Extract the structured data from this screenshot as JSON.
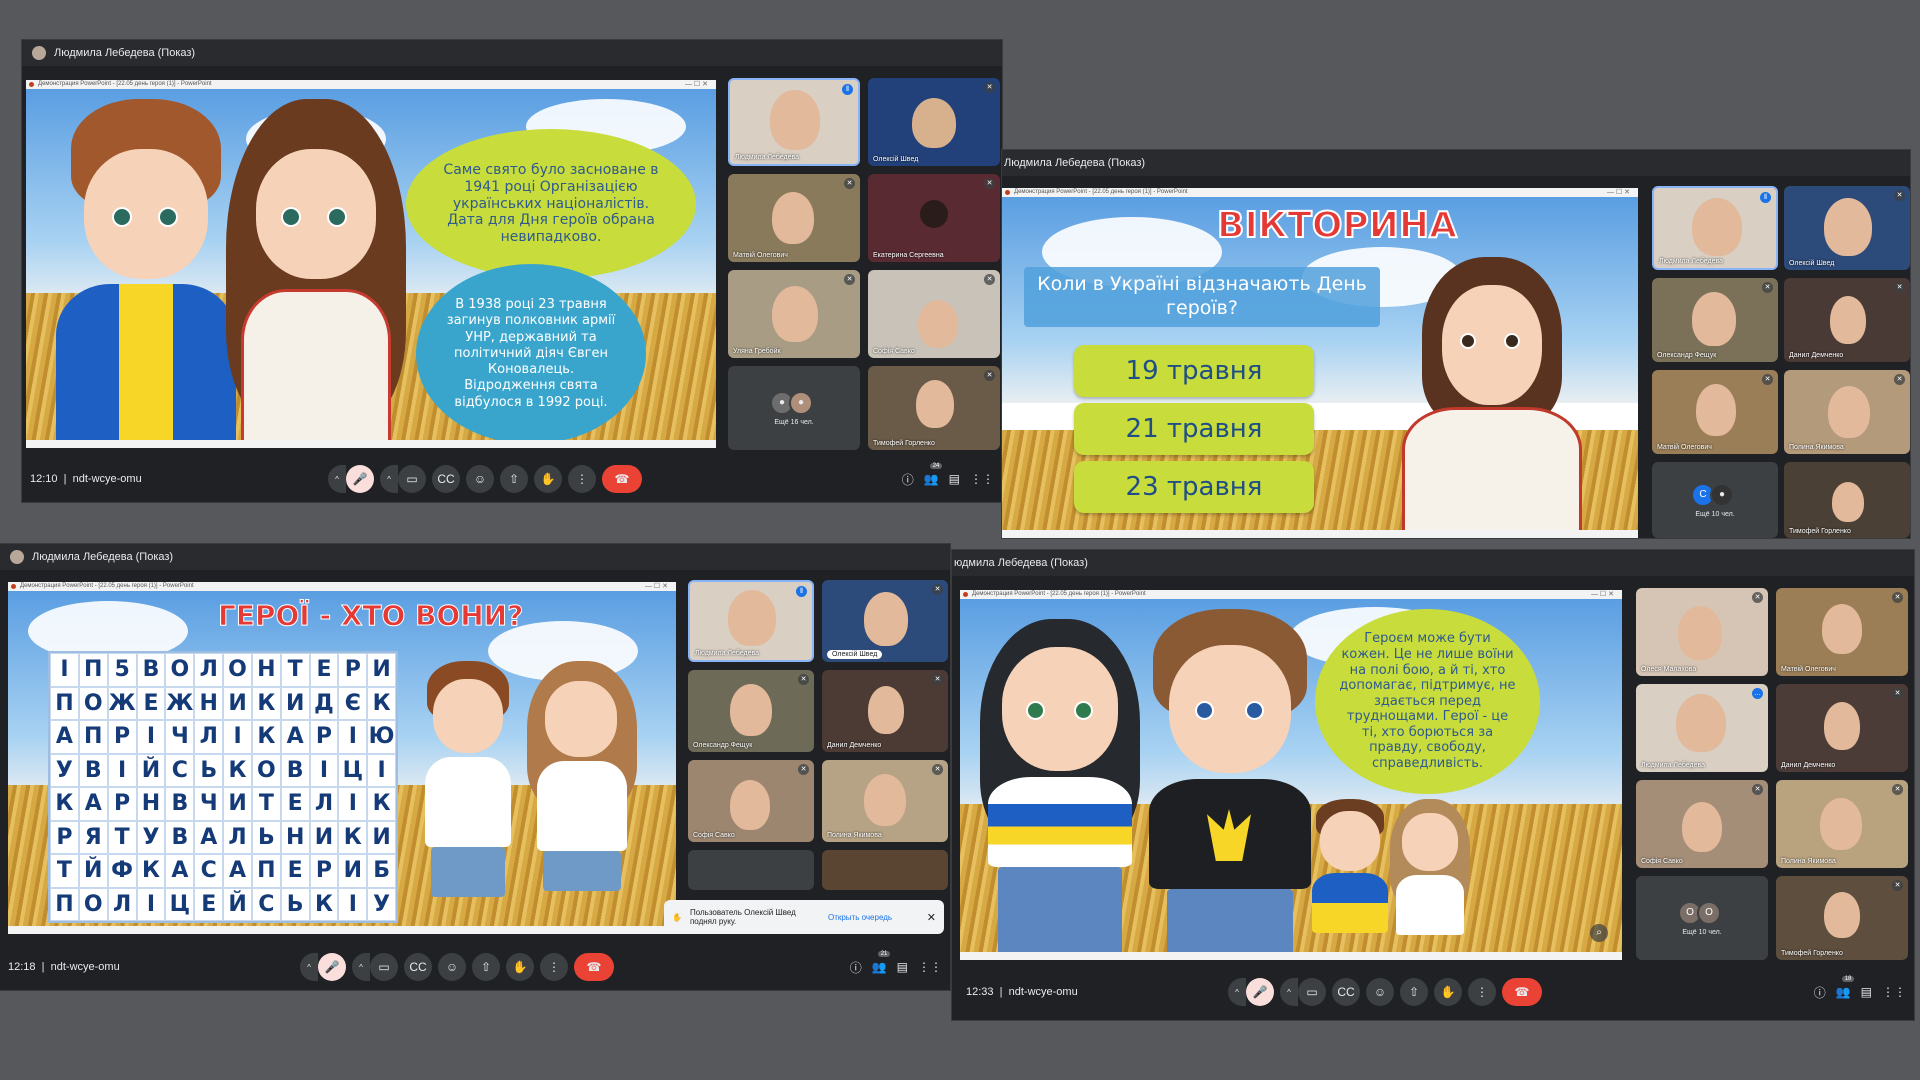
{
  "presenter_title": "Людмила Лебедева (Показ)",
  "presenter_title_cut": "юдмила Лебедева (Показ)",
  "ppt_window_title": "Демонстрация PowerPoint - [22.05 день героя (1)] - PowerPoint",
  "meeting_code": "ndt-wcye-omu",
  "panel1": {
    "time": "12:10",
    "bubble_green": "Саме свято було засноване в 1941 році Організацією українських націоналістів. Дата для Дня героїв обрана невипадково.",
    "bubble_blue": "В 1938 році 23 травня загинув полковник армії УНР, державний та політичний діяч Євген Коновалець. Відродження свята відбулося в 1992 році.",
    "participants_badge": "24",
    "tiles": [
      "Людмила Лебедева",
      "Олексій Швед",
      "Матвій Олегович",
      "Екатерина Сергеевна",
      "Уляна Гребойк",
      "Софія Савко",
      "Ещё 16 чел.",
      "Тимофей Горленко"
    ]
  },
  "panel2": {
    "title": "ВІКТОРИНА",
    "question": "Коли в Україні відзначають День героїв?",
    "options": [
      "19 травня",
      "21 травня",
      "23 травня"
    ],
    "tiles": [
      "Людмила Лебедева",
      "Олексій Швед",
      "Олександр Фещук",
      "Данил Демченко",
      "Матвій Олегович",
      "Полина Якимова",
      "Ещё 10 чел.",
      "Тимофей Горленко"
    ]
  },
  "panel3": {
    "time": "12:18",
    "title": "ГЕРОЇ - ХТО ВОНИ?",
    "grid": [
      [
        "І",
        "П",
        "5",
        "В",
        "О",
        "Л",
        "О",
        "Н",
        "Т",
        "Е",
        "Р",
        "И"
      ],
      [
        "П",
        "О",
        "Ж",
        "Е",
        "Ж",
        "Н",
        "И",
        "К",
        "И",
        "Д",
        "Є",
        "К"
      ],
      [
        "А",
        "П",
        "Р",
        "І",
        "Ч",
        "Л",
        "І",
        "К",
        "А",
        "Р",
        "І",
        "Ю"
      ],
      [
        "У",
        "В",
        "І",
        "Й",
        "С",
        "Ь",
        "К",
        "О",
        "В",
        "І",
        "Ц",
        "І"
      ],
      [
        "К",
        "А",
        "Р",
        "Н",
        "В",
        "Ч",
        "И",
        "Т",
        "Е",
        "Л",
        "І",
        "К"
      ],
      [
        "Р",
        "Я",
        "Т",
        "У",
        "В",
        "А",
        "Л",
        "Ь",
        "Н",
        "И",
        "К",
        "И"
      ],
      [
        "Т",
        "Й",
        "Ф",
        "К",
        "А",
        "С",
        "А",
        "П",
        "Е",
        "Р",
        "И",
        "Б"
      ],
      [
        "П",
        "О",
        "Л",
        "І",
        "Ц",
        "Е",
        "Й",
        "С",
        "Ь",
        "К",
        "І",
        "У"
      ]
    ],
    "toast_text": "Пользователь Олексій Швед поднял руку.",
    "toast_link": "Открыть очередь",
    "participants_badge": "21",
    "tiles": [
      "Людмила Лебедева",
      "Олексій Швед",
      "Олександр Фещук",
      "Данил Демченко",
      "Софія Савко",
      "Полина Якимова",
      "",
      ""
    ]
  },
  "panel4": {
    "time": "12:33",
    "bubble": "Героєм може бути кожен. Це не лише воїни на полі бою, а й ті, хто допомагає, підтримує, не здається перед труднощами. Герої - це ті, хто борються за правду, свободу, справедливість.",
    "participants_badge": "18",
    "tiles": [
      "Олеся Малахова",
      "Матвій Олегович",
      "Людмила Лебедева",
      "Данил Демченко",
      "Софія Савко",
      "Полина Якимова",
      "Ещё 10 чел.",
      "Тимофей Горленко"
    ]
  },
  "more_avatars": [
    "C",
    "O"
  ],
  "colors": {
    "end_call": "#ea4335",
    "slide_green": "#c8dc3c",
    "slide_blue": "#3aa5cc",
    "quiz_red": "#e53935"
  },
  "icons": [
    "chevron-up-icon",
    "mic-off-icon",
    "camera-icon",
    "captions-icon",
    "emoji-icon",
    "present-icon",
    "raise-hand-icon",
    "more-options-icon",
    "end-call-icon",
    "info-icon",
    "people-icon",
    "chat-icon",
    "activities-icon"
  ]
}
